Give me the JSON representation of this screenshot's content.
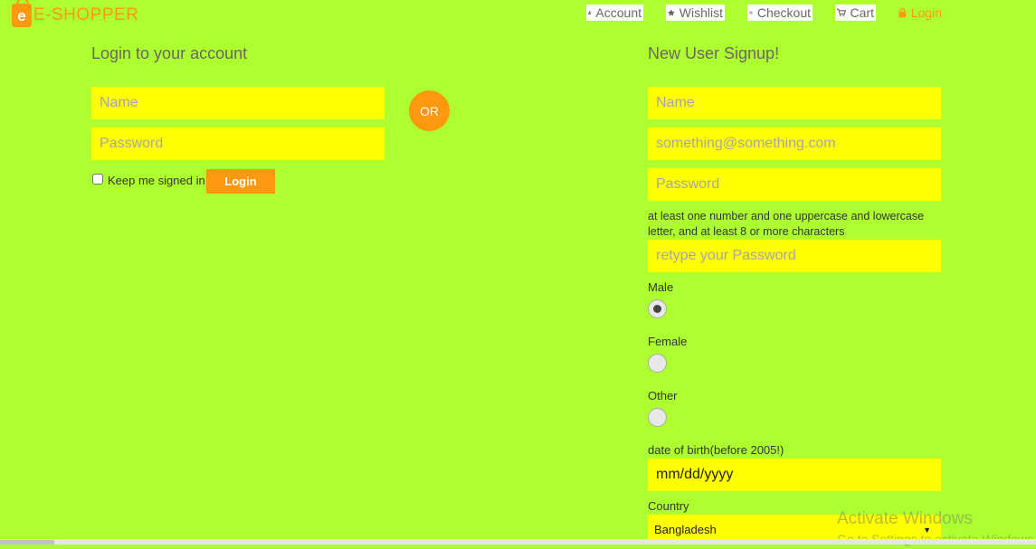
{
  "brand": {
    "logo_letter": "e",
    "name": "E-SHOPPER"
  },
  "nav": {
    "account": "Account",
    "wishlist": "Wishlist",
    "checkout": "Checkout",
    "cart": "Cart",
    "login": "Login"
  },
  "login_form": {
    "title": "Login to your account",
    "name_placeholder": "Name",
    "password_placeholder": "Password",
    "keep_signed_in": "Keep me signed in",
    "login_button": "Login"
  },
  "or_label": "OR",
  "signup_form": {
    "title": "New User Signup!",
    "name_placeholder": "Name",
    "email_placeholder": "something@something.com",
    "password_placeholder": "Password",
    "password_hint": "at least one number and one uppercase and lowercase letter, and at least 8 or more characters",
    "retype_placeholder": "retype your Password",
    "gender_options": [
      {
        "label": "Male",
        "selected": true
      },
      {
        "label": "Female",
        "selected": false
      },
      {
        "label": "Other",
        "selected": false
      }
    ],
    "dob_label": "date of birth(before 2005!)",
    "dob_value": "mm/dd/yyyy",
    "country_label": "Country",
    "country_value": "Bangladesh"
  },
  "watermark": {
    "line1": "Activate Windows",
    "line2": "Go to Settings to activate Windows."
  },
  "colors": {
    "page_bg": "#adff2f",
    "input_bg": "#ffff00",
    "accent": "#fe980f"
  }
}
